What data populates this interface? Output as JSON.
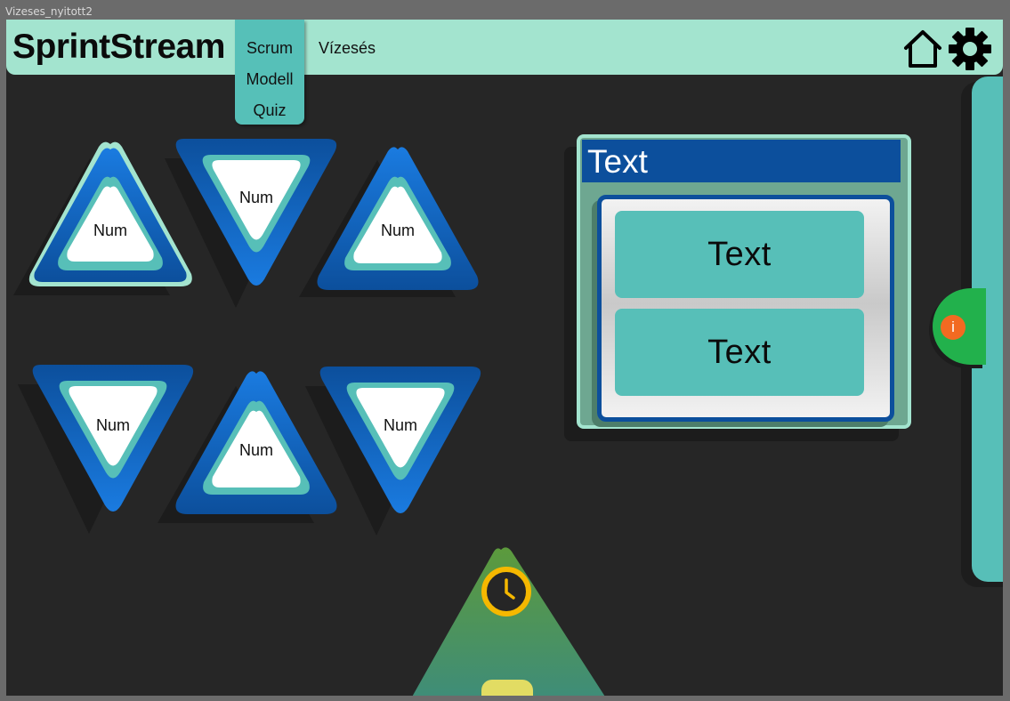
{
  "window": {
    "title": "Vizeses_nyitott2"
  },
  "header": {
    "brand": "SprintStream",
    "menu": {
      "dropdown_items": [
        "Scrum",
        "Modell",
        "Quiz"
      ],
      "top_item": "Vízesés"
    },
    "icons": {
      "home": "home-icon",
      "settings": "gear-icon"
    }
  },
  "triangles": [
    "Num",
    "Num",
    "Num",
    "Num",
    "Num",
    "Num"
  ],
  "card": {
    "title": "Text",
    "buttons": [
      "Text",
      "Text"
    ]
  },
  "info": {
    "glyph": "i"
  },
  "timer": {
    "icon": "clock-icon"
  },
  "colors": {
    "background": "#262626",
    "header": "#a3e4cf",
    "teal": "#57bfb8",
    "blue": "#0c4f9c",
    "info_green": "#22b14c",
    "info_orange": "#f26a21",
    "clock_yellow": "#f5b800"
  }
}
